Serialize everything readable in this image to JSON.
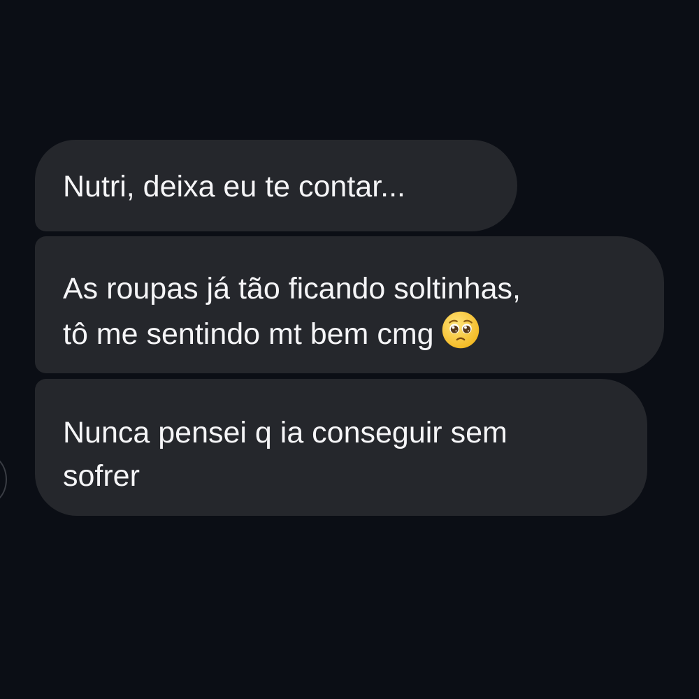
{
  "chat": {
    "messages": [
      {
        "lines": [
          "Nutri, deixa eu te contar..."
        ]
      },
      {
        "lines": [
          "As roupas já tão ficando soltinhas,",
          "tô me sentindo mt bem cmg"
        ],
        "emoji": "pleading-face"
      },
      {
        "lines": [
          "Nunca pensei q ia conseguir sem",
          "sofrer"
        ]
      }
    ]
  },
  "colors": {
    "background": "#0b0e15",
    "bubble": "#25272c",
    "text": "#f5f5f7",
    "emoji_face": "#f7c535"
  },
  "icons": {
    "avatar": "avatar-icon",
    "emoji": "pleading-face-emoji-icon"
  }
}
